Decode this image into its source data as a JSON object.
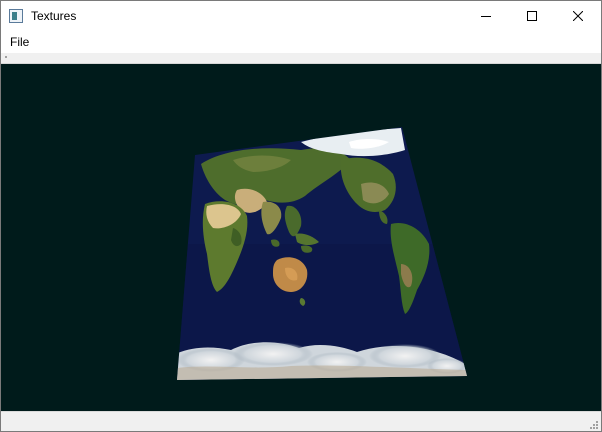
{
  "window": {
    "title": "Textures"
  },
  "menu": {
    "items": [
      {
        "label": "File"
      }
    ]
  },
  "viewport": {
    "background": "#001b1b",
    "content": "textured-earth-quad"
  },
  "colors": {
    "ocean": "#0d1a4e",
    "land_green": "#4e6d2c",
    "desert": "#c9ae7a",
    "ice": "#dde4ea"
  }
}
